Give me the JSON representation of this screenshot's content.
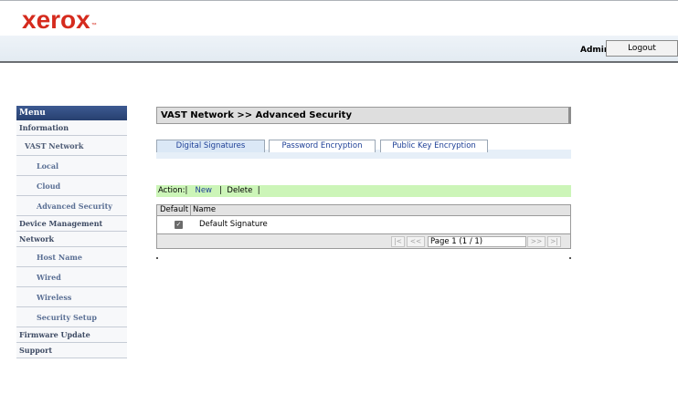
{
  "header": {
    "logo": "xerox",
    "logo_tm": "™",
    "user": "Admin",
    "logout_label": "Logout"
  },
  "menu": {
    "title": "Menu",
    "items": [
      {
        "label": "Information"
      },
      {
        "label": "VAST Network"
      },
      {
        "label": "Local"
      },
      {
        "label": "Cloud"
      },
      {
        "label": "Advanced Security"
      },
      {
        "label": "Device Management"
      },
      {
        "label": "Network"
      },
      {
        "label": "Host Name"
      },
      {
        "label": "Wired"
      },
      {
        "label": "Wireless"
      },
      {
        "label": "Security Setup"
      },
      {
        "label": "Firmware Update"
      },
      {
        "label": "Support"
      }
    ]
  },
  "page": {
    "title": "VAST Network >> Advanced Security",
    "tabs": [
      {
        "label": "Digital Signatures",
        "active": true
      },
      {
        "label": "Password Encryption",
        "active": false
      },
      {
        "label": "Public Key Encryption",
        "active": false
      }
    ],
    "actions": {
      "prefix": "Action:|",
      "new_label": "New",
      "sep1": "|",
      "delete_label": "Delete",
      "sep2": "|"
    },
    "table": {
      "columns": [
        "Default",
        "Name"
      ],
      "rows": [
        {
          "default": true,
          "name": "Default Signature"
        }
      ]
    },
    "pager": {
      "first": "|<",
      "prev": "<<",
      "page_text": "Page 1 (1 / 1)",
      "next": ">>",
      "last": ">|"
    }
  }
}
